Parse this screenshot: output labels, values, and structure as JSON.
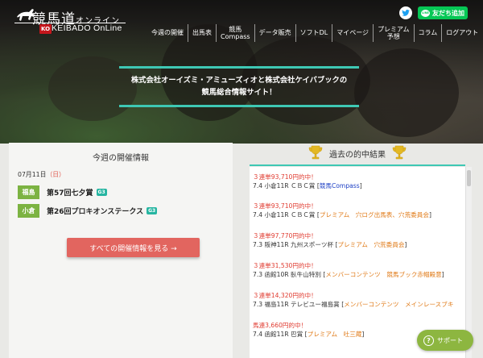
{
  "header": {
    "logo_jp": "競馬道",
    "logo_kana": "オンライン",
    "logo_ko": "KO",
    "logo_en": "KEIBADO OnLine",
    "line_button": "友だち追加",
    "line_icon_text": "LINE",
    "nav": [
      {
        "label": "今週の開催"
      },
      {
        "label": "出馬表"
      },
      {
        "label": "競馬\nCompass"
      },
      {
        "label": "データ販売"
      },
      {
        "label": "ソフトDL"
      },
      {
        "label": "マイページ"
      },
      {
        "label": "プレミアム\n予想"
      },
      {
        "label": "コラム"
      },
      {
        "label": "ログアウト"
      }
    ],
    "banner_line1": "株式会社オーイズミ・アミューズィオと株式会社ケイバブックの",
    "banner_line2": "競馬総合情報サイト！"
  },
  "weekly": {
    "title": "今週の開催情報",
    "date": "07月11日",
    "dow": "（日）",
    "races": [
      {
        "venue": "福島",
        "name": "第57回七夕賞",
        "grade": "G3"
      },
      {
        "venue": "小倉",
        "name": "第26回プロキオンステークス",
        "grade": "G3"
      }
    ],
    "all_button": "すべての開催情報を見る →"
  },
  "results": {
    "title": "過去の的中結果",
    "items": [
      {
        "payout": "３連単93,710円的中！",
        "desc": "7.4 小倉11R ＣＢＣ賞 [",
        "source": "競馬Compass",
        "tail": "]",
        "src_color": "blue"
      },
      {
        "payout": "３連単93,710円的中！",
        "desc": "7.4 小倉11R ＣＢＣ賞 [",
        "source": "プレミアム　穴ログ出馬表、穴荒委員会",
        "tail": "]",
        "src_color": "orange"
      },
      {
        "payout": "３連単97,770円的中！",
        "desc": "7.3 阪神11R 九州スポーツ杯 [",
        "source": "プレミアム　穴荒委員会",
        "tail": "]",
        "src_color": "orange"
      },
      {
        "payout": "３連単31,530円的中！",
        "desc": "7.3 函館10R 臥牛山特別 [",
        "source": "メンバーコンテンツ　競馬ブック赤帽殿意",
        "tail": "]",
        "src_color": "orange"
      },
      {
        "payout": "３連単14,320円的中！",
        "desc": "7.3 福島11R テレビユー福島賞 [",
        "source": "メンバーコンテンツ　メインレースブキ",
        "tail": "",
        "src_color": "orange"
      },
      {
        "payout": "馬連3,660円的中！",
        "desc": "7.4 函館11R 巴賞 [",
        "source": "プレミアム　吐三蔵",
        "tail": "]",
        "src_color": "orange"
      }
    ]
  },
  "support": {
    "label": "サポート",
    "icon": "?"
  }
}
